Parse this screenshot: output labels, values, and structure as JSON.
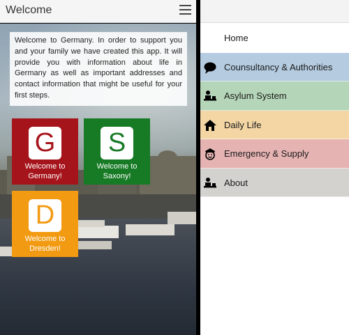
{
  "app": {
    "title": "Welcome"
  },
  "intro": {
    "text": "Welcome to Germany. In order to support you and your family we have created this app. It will provide you with information about life in Germany as well as important addresses and contact information that might be useful for your first steps."
  },
  "tiles": [
    {
      "letter": "G",
      "label": "Welcome to Germany!",
      "color": "#a6141b"
    },
    {
      "letter": "S",
      "label": "Welcome to Saxony!",
      "color": "#177a25"
    },
    {
      "letter": "D",
      "label": "Welcome to Dresden!",
      "color": "#f29a12"
    }
  ],
  "menu": {
    "items": [
      {
        "label": "Home",
        "icon": "none",
        "color": "#ffffff"
      },
      {
        "label": "Counsultancy & Authorities",
        "icon": "speech-bubble-icon",
        "color": "#b4cbe0"
      },
      {
        "label": "Asylum System",
        "icon": "desk-person-icon",
        "color": "#b4d5b7"
      },
      {
        "label": "Daily Life",
        "icon": "house-icon",
        "color": "#f3d6a4"
      },
      {
        "label": "Emergency & Supply",
        "icon": "officer-icon",
        "color": "#e6b3b3"
      },
      {
        "label": "About",
        "icon": "desk-person-icon",
        "color": "#d4d2cf"
      }
    ]
  }
}
